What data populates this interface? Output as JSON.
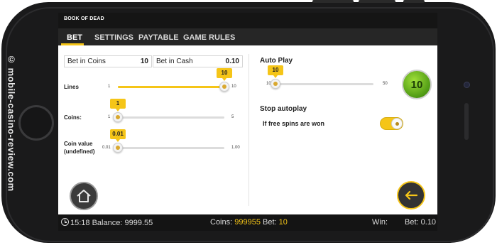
{
  "watermark": "© mobile-casino-review.com",
  "game": {
    "title": "BOOK OF DEAD"
  },
  "tabs": [
    {
      "label": "BET",
      "active": true
    },
    {
      "label": "SETTINGS",
      "active": false
    },
    {
      "label": "PAYTABLE",
      "active": false
    },
    {
      "label": "GAME RULES",
      "active": false
    }
  ],
  "bet": {
    "coins_label": "Bet in Coins",
    "coins_value": "10",
    "cash_label": "Bet in Cash",
    "cash_value": "0.10",
    "lines": {
      "label": "Lines",
      "min": "1",
      "max": "10",
      "value": "10",
      "fraction": 1.0
    },
    "coins": {
      "label": "Coins:",
      "min": "1",
      "max": "5",
      "value": "1",
      "fraction": 0.0
    },
    "coin_value": {
      "label_line1": "Coin value",
      "label_line2": "(undefined)",
      "min": "0.01",
      "max": "1.00",
      "value": "0.01",
      "fraction": 0.0
    }
  },
  "autoplay": {
    "title": "Auto Play",
    "min": "10",
    "max": "50",
    "value": "10",
    "fraction": 0.0,
    "button_label": "10",
    "stop_title": "Stop autoplay",
    "free_spins_label": "If free spins are won",
    "free_spins_on": true
  },
  "status": {
    "clock": "15:18",
    "balance_label": "Balance:",
    "balance_value": "9999.55",
    "coins_label": "Coins:",
    "coins_value": "999955",
    "bet_label": "Bet:",
    "bet_value": "10",
    "win_label": "Win:",
    "bet_cash_label": "Bet:",
    "bet_cash_value": "0.10"
  },
  "colors": {
    "accent": "#f5c518",
    "autoplay_green": "#6cc21c",
    "bar_dark": "#141414"
  },
  "icons": {
    "home": "home-icon",
    "back": "arrow-left-icon",
    "clock": "clock-icon"
  }
}
